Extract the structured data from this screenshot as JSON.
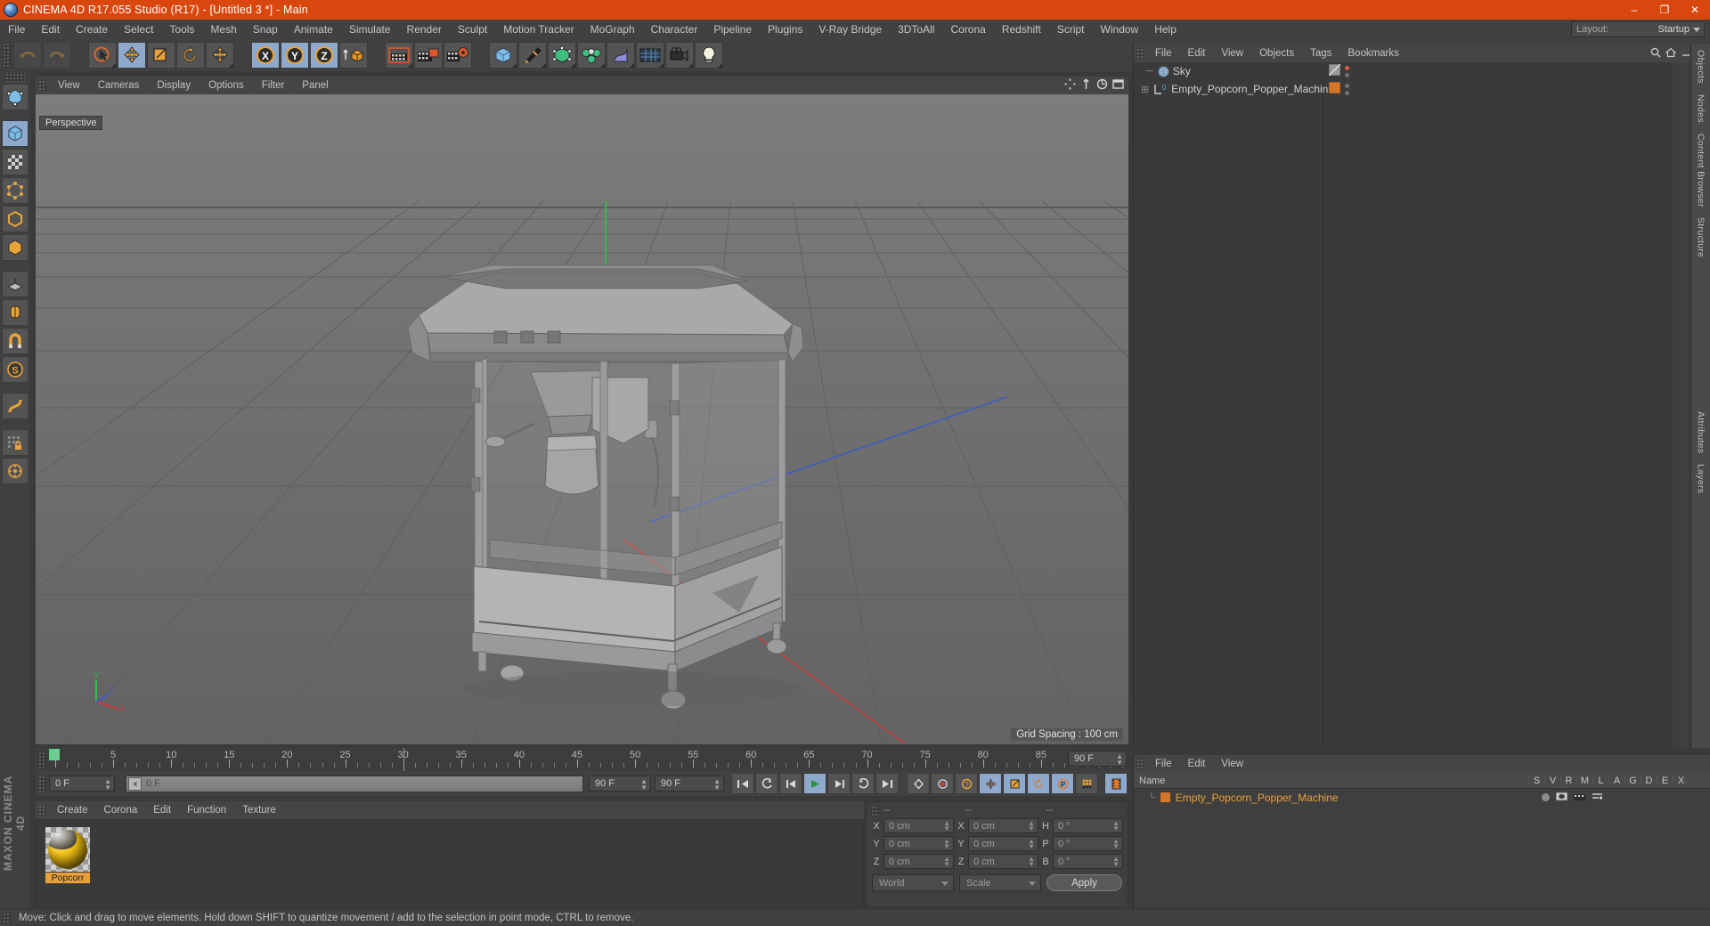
{
  "window": {
    "title": "CINEMA 4D R17.055 Studio (R17) - [Untitled 3 *] - Main",
    "app_icon": "c4d-logo-icon",
    "minimize": "–",
    "maximize": "❐",
    "close": "✕",
    "accent": "#d9470f"
  },
  "menubar": {
    "items": [
      {
        "label": "File"
      },
      {
        "label": "Edit"
      },
      {
        "label": "Create"
      },
      {
        "label": "Select"
      },
      {
        "label": "Tools"
      },
      {
        "label": "Mesh"
      },
      {
        "label": "Snap"
      },
      {
        "label": "Animate"
      },
      {
        "label": "Simulate"
      },
      {
        "label": "Render"
      },
      {
        "label": "Sculpt"
      },
      {
        "label": "Motion Tracker"
      },
      {
        "label": "MoGraph"
      },
      {
        "label": "Character"
      },
      {
        "label": "Pipeline"
      },
      {
        "label": "Plugins"
      },
      {
        "label": "V-Ray Bridge"
      },
      {
        "label": "3DToAll"
      },
      {
        "label": "Corona"
      },
      {
        "label": "Redshift"
      },
      {
        "label": "Script"
      },
      {
        "label": "Window"
      },
      {
        "label": "Help"
      }
    ]
  },
  "layout_selector": {
    "label": "Layout:",
    "value": "Startup"
  },
  "toolbar": {
    "groups": [
      {
        "name": "undo-redo",
        "buttons": [
          {
            "name": "undo-button",
            "icon": "undo-icon",
            "state": "disabled"
          },
          {
            "name": "redo-button",
            "icon": "redo-icon",
            "state": "disabled"
          }
        ]
      },
      {
        "name": "transform-tools",
        "buttons": [
          {
            "name": "live-selection-tool",
            "icon": "cursor-circle-icon",
            "state": "normal"
          },
          {
            "name": "move-tool",
            "icon": "move-arrows-icon",
            "state": "active"
          },
          {
            "name": "scale-tool",
            "icon": "scale-box-icon",
            "state": "normal"
          },
          {
            "name": "rotate-tool",
            "icon": "rotate-arc-icon",
            "state": "normal"
          },
          {
            "name": "universal-tool",
            "icon": "move-arrows-icon",
            "state": "normal"
          }
        ]
      },
      {
        "name": "axis-locks",
        "buttons": [
          {
            "name": "lock-x-axis-button",
            "icon": "x-axis-icon",
            "state": "active"
          },
          {
            "name": "lock-y-axis-button",
            "icon": "y-axis-icon",
            "state": "active"
          },
          {
            "name": "lock-z-axis-button",
            "icon": "z-axis-icon",
            "state": "active"
          },
          {
            "name": "world-object-coord-button",
            "icon": "world-cube-icon",
            "state": "normal"
          }
        ]
      },
      {
        "name": "render-tools",
        "buttons": [
          {
            "name": "render-view-button",
            "icon": "clapperboard-icon",
            "state": "normal"
          },
          {
            "name": "render-to-picture-viewer-button",
            "icon": "clapperboard-picture-icon",
            "state": "normal"
          },
          {
            "name": "render-settings-button",
            "icon": "clapperboard-gear-icon",
            "state": "normal"
          }
        ]
      },
      {
        "name": "create-objects",
        "buttons": [
          {
            "name": "add-cube-button",
            "icon": "cube-icon",
            "state": "normal"
          },
          {
            "name": "add-spline-button",
            "icon": "pen-icon",
            "state": "normal"
          },
          {
            "name": "add-generator-button",
            "icon": "green-nurbs-icon",
            "state": "normal"
          },
          {
            "name": "add-array-button",
            "icon": "green-array-icon",
            "state": "normal"
          },
          {
            "name": "add-deformer-button",
            "icon": "bend-deformer-icon",
            "state": "normal"
          },
          {
            "name": "add-environment-button",
            "icon": "floor-env-icon",
            "state": "normal"
          },
          {
            "name": "add-camera-button",
            "icon": "camera-icon",
            "state": "normal"
          },
          {
            "name": "add-light-button",
            "icon": "light-bulb-icon",
            "state": "normal"
          }
        ]
      }
    ]
  },
  "left_toolbar": {
    "buttons": [
      {
        "name": "make-editable-button",
        "icon": "editable-icon"
      },
      {
        "name": "model-mode-button",
        "icon": "model-mode-icon"
      },
      {
        "name": "texture-mode-button",
        "icon": "texture-mode-icon"
      },
      {
        "name": "point-mode-button",
        "icon": "points-icon"
      },
      {
        "name": "edge-mode-button",
        "icon": "edges-icon"
      },
      {
        "name": "polygon-mode-button",
        "icon": "polygons-icon"
      },
      {
        "name": "workplane-button",
        "icon": "workplane-icon"
      },
      {
        "name": "enable-axis-button",
        "icon": "axis-icon"
      },
      {
        "name": "enable-snap-button",
        "icon": "snap-magnet-icon"
      },
      {
        "name": "viewport-solo-button",
        "icon": "solo-s-icon"
      },
      {
        "name": "deformer-toggle-button",
        "icon": "deformer-bend-icon"
      },
      {
        "name": "lock-selection-button",
        "icon": "grid-lock-icon"
      },
      {
        "name": "quantize-button",
        "icon": "quantize-icon"
      }
    ],
    "brand": "MAXON CINEMA 4D"
  },
  "viewport": {
    "menu": [
      {
        "label": "View"
      },
      {
        "label": "Cameras"
      },
      {
        "label": "Display"
      },
      {
        "label": "Options"
      },
      {
        "label": "Filter"
      },
      {
        "label": "Panel"
      }
    ],
    "camera_label": "Perspective",
    "grid_spacing": "Grid Spacing : 100 cm",
    "axis_labels": {
      "x": "X",
      "y": "Y",
      "z": "Z"
    },
    "background_color": "#6e6e6e",
    "model_name": "Empty Popcorn Popper Machine"
  },
  "object_manager": {
    "menu": [
      {
        "label": "File"
      },
      {
        "label": "Edit"
      },
      {
        "label": "View"
      },
      {
        "label": "Objects"
      },
      {
        "label": "Tags"
      },
      {
        "label": "Bookmarks"
      }
    ],
    "objects": [
      {
        "name": "Sky",
        "icon": "sky-sphere-icon",
        "tag_color": "#9a9a9a",
        "tag_icon": "sky-tag-icon",
        "indicator": "red"
      },
      {
        "name": "Empty_Popcorn_Popper_Machine",
        "icon": "null-object-icon",
        "tag_color": "#d4762a",
        "tag_icon": "material-tag-icon",
        "indicator": "grey"
      }
    ]
  },
  "right_rail": {
    "tabs": [
      "Objects",
      "Nodes",
      "Content Browser",
      "Structure",
      "Attributes",
      "Layers"
    ]
  },
  "timeline": {
    "start_frame": "0 F",
    "end_frame": "90 F",
    "current_frame": "0 F",
    "preview_frame": "0 F",
    "ticks": [
      {
        "label": "0",
        "value": 0
      },
      {
        "label": "5",
        "value": 5
      },
      {
        "label": "10",
        "value": 10
      },
      {
        "label": "15",
        "value": 15
      },
      {
        "label": "20",
        "value": 20
      },
      {
        "label": "25",
        "value": 25
      },
      {
        "label": "30",
        "value": 30
      },
      {
        "label": "35",
        "value": 35
      },
      {
        "label": "40",
        "value": 40
      },
      {
        "label": "45",
        "value": 45
      },
      {
        "label": "50",
        "value": 50
      },
      {
        "label": "55",
        "value": 55
      },
      {
        "label": "60",
        "value": 60
      },
      {
        "label": "65",
        "value": 65
      },
      {
        "label": "70",
        "value": 70
      },
      {
        "label": "75",
        "value": 75
      },
      {
        "label": "80",
        "value": 80
      },
      {
        "label": "85",
        "value": 85
      },
      {
        "label": "90",
        "value": 90
      }
    ],
    "max": 92,
    "playback_buttons": [
      {
        "name": "go-to-start-button",
        "icon": "skip-back-icon"
      },
      {
        "name": "step-back-keyframe-button",
        "icon": "prev-key-icon"
      },
      {
        "name": "step-back-frame-button",
        "icon": "step-back-icon"
      },
      {
        "name": "play-button",
        "icon": "play-icon",
        "state": "active"
      },
      {
        "name": "step-forward-frame-button",
        "icon": "step-forward-icon"
      },
      {
        "name": "step-forward-keyframe-button",
        "icon": "next-key-icon"
      },
      {
        "name": "go-to-end-button",
        "icon": "skip-forward-icon"
      }
    ],
    "record_buttons": [
      {
        "name": "record-active-objects-button",
        "icon": "key-record-icon"
      },
      {
        "name": "autokeying-button",
        "icon": "red-dot-icon"
      },
      {
        "name": "keyframe-selection-button",
        "icon": "question-key-icon"
      },
      {
        "name": "position-key-button",
        "icon": "position-key-icon",
        "state": "active"
      },
      {
        "name": "scale-key-button",
        "icon": "scale-key-icon",
        "state": "active"
      },
      {
        "name": "rotation-key-button",
        "icon": "rotate-key-icon",
        "state": "active"
      },
      {
        "name": "param-key-button",
        "icon": "param-p-icon",
        "state": "active"
      },
      {
        "name": "point-level-animation-button",
        "icon": "pla-dots-icon"
      },
      {
        "name": "timeline-button",
        "icon": "film-strip-icon",
        "state": "active"
      }
    ]
  },
  "timeline_manager": {
    "menu": [
      {
        "label": "File"
      },
      {
        "label": "Edit"
      },
      {
        "label": "View"
      }
    ],
    "columns": [
      "Name",
      "S",
      "V",
      "R",
      "M",
      "L",
      "A",
      "G",
      "D",
      "E",
      "X"
    ],
    "rows": [
      {
        "name": "Empty_Popcorn_Popper_Machine",
        "color": "#d4762a"
      }
    ]
  },
  "material_manager": {
    "menu": [
      {
        "label": "Create"
      },
      {
        "label": "Corona"
      },
      {
        "label": "Edit"
      },
      {
        "label": "Function"
      },
      {
        "label": "Texture"
      }
    ],
    "materials": [
      {
        "name": "Popcorr",
        "icon": "material-sphere-icon",
        "selected": true
      }
    ]
  },
  "coordinate_manager": {
    "headers": [
      "--",
      "--",
      "--"
    ],
    "rows": [
      {
        "pos_label": "X",
        "pos_value": "0 cm",
        "size_label": "X",
        "size_value": "0 cm",
        "rot_label": "H",
        "rot_value": "0 °"
      },
      {
        "pos_label": "Y",
        "pos_value": "0 cm",
        "size_label": "Y",
        "size_value": "0 cm",
        "rot_label": "P",
        "rot_value": "0 °"
      },
      {
        "pos_label": "Z",
        "pos_value": "0 cm",
        "size_label": "Z",
        "size_value": "0 cm",
        "rot_label": "B",
        "rot_value": "0 °"
      }
    ],
    "coord_system": "World",
    "mode": "Scale",
    "apply_label": "Apply"
  },
  "status_bar": {
    "message": "Move: Click and drag to move elements. Hold down SHIFT to quantize movement / add to the selection in point mode, CTRL to remove."
  }
}
